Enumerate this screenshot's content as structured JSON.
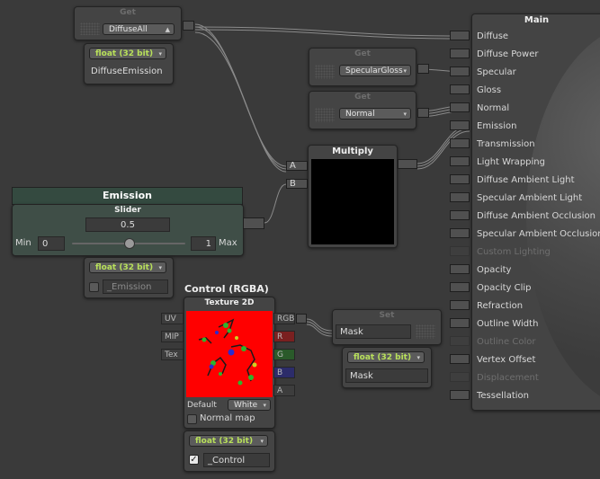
{
  "get_nodes": [
    {
      "title": "Get",
      "value": "DiffuseAll"
    },
    {
      "title": "Get",
      "value": "SpecularGloss"
    },
    {
      "title": "Get",
      "value": "Normal"
    }
  ],
  "diffuse_emission": {
    "type": "float (32 bit)",
    "name": "DiffuseEmission"
  },
  "multiply": {
    "title": "Multiply",
    "inputs": [
      "A",
      "B"
    ]
  },
  "emission": {
    "header": "Emission",
    "sub": "Slider",
    "value": "0.5",
    "min_label": "Min",
    "min": "0",
    "max": "1",
    "max_label": "Max",
    "slider_fraction": 0.5
  },
  "emission_prop": {
    "type": "float (32 bit)",
    "name": "_Emission",
    "checked": false
  },
  "control": {
    "title": "Control (RGBA)",
    "sub": "Texture 2D",
    "inputs": [
      "UV",
      "MIP",
      "Tex"
    ],
    "outputs": [
      "RGB",
      "R",
      "G",
      "B",
      "A"
    ],
    "default_label": "Default",
    "default_value": "White",
    "normal_map_label": "Normal map"
  },
  "control_prop": {
    "type": "float (32 bit)",
    "name": "_Control",
    "checked": true
  },
  "set_node": {
    "title": "Set",
    "value": "Mask"
  },
  "mask_prop": {
    "type": "float (32 bit)",
    "name": "Mask"
  },
  "main": {
    "title": "Main",
    "ports": [
      {
        "label": "Diffuse",
        "enabled": true
      },
      {
        "label": "Diffuse Power",
        "enabled": true
      },
      {
        "label": "Specular",
        "enabled": true
      },
      {
        "label": "Gloss",
        "enabled": true
      },
      {
        "label": "Normal",
        "enabled": true
      },
      {
        "label": "Emission",
        "enabled": true
      },
      {
        "label": "Transmission",
        "enabled": true
      },
      {
        "label": "Light Wrapping",
        "enabled": true
      },
      {
        "label": "Diffuse Ambient Light",
        "enabled": true
      },
      {
        "label": "Specular Ambient Light",
        "enabled": true
      },
      {
        "label": "Diffuse Ambient Occlusion",
        "enabled": true
      },
      {
        "label": "Specular Ambient Occlusion",
        "enabled": true
      },
      {
        "label": "Custom Lighting",
        "enabled": false
      },
      {
        "label": "Opacity",
        "enabled": true
      },
      {
        "label": "Opacity Clip",
        "enabled": true
      },
      {
        "label": "Refraction",
        "enabled": true
      },
      {
        "label": "Outline Width",
        "enabled": true
      },
      {
        "label": "Outline Color",
        "enabled": false
      },
      {
        "label": "Vertex Offset",
        "enabled": true
      },
      {
        "label": "Displacement",
        "enabled": false
      },
      {
        "label": "Tessellation",
        "enabled": true
      }
    ]
  },
  "colors": {
    "canvas": "#3a3a3a",
    "node": "#444444",
    "texture_bg": "#ff0000",
    "accent_green": "#b8e05a",
    "emission_header": "#344a40"
  },
  "icons": {
    "dropdown": "dropdown-arrow-icon",
    "checkbox": "checkbox-icon"
  }
}
